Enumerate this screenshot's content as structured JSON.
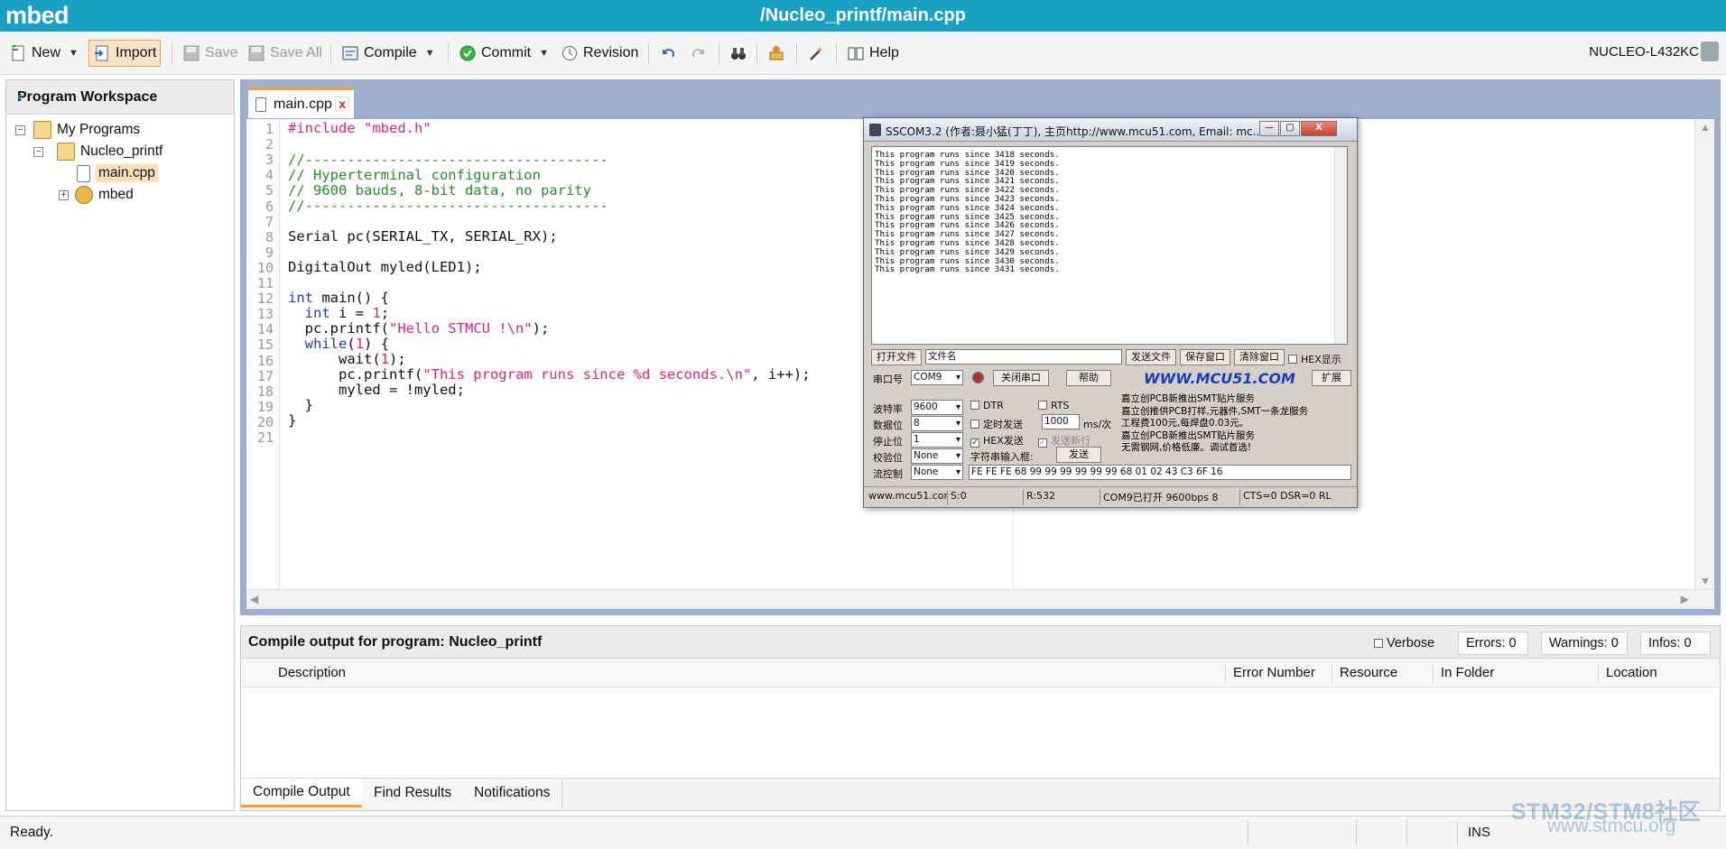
{
  "app": {
    "brand": "mbed",
    "path": "/Nucleo_printf/main.cpp"
  },
  "toolbar": {
    "new": "New",
    "import": "Import",
    "save": "Save",
    "save_all": "Save All",
    "compile": "Compile",
    "commit": "Commit",
    "revision": "Revision",
    "help": "Help",
    "board": "NUCLEO-L432KC"
  },
  "workspace": {
    "title": "Program Workspace",
    "root": "My Programs",
    "program": "Nucleo_printf",
    "file": "main.cpp",
    "lib": "mbed"
  },
  "editor": {
    "tab": "main.cpp",
    "tab_close": "x",
    "line_numbers": [
      "1",
      "2",
      "3",
      "4",
      "5",
      "6",
      "7",
      "8",
      "9",
      "10",
      "11",
      "12",
      "13",
      "14",
      "15",
      "16",
      "17",
      "18",
      "19",
      "20",
      "21"
    ]
  },
  "code": {
    "l1": "#include \"mbed.h\"",
    "l3": "//------------------------------------",
    "l4": "// Hyperterminal configuration",
    "l5": "// 9600 bauds, 8-bit data, no parity",
    "l6": "//------------------------------------",
    "l8": "Serial pc(SERIAL_TX, SERIAL_RX);",
    "l10": "DigitalOut myled(LED1);",
    "l12a": "int",
    "l12b": " main() {",
    "l13a": "  ",
    "l13b": "int",
    "l13c": " i = ",
    "l13d": "1",
    "l13e": ";",
    "l14a": "  pc.printf(",
    "l14b": "\"Hello STMCU !\\n\"",
    "l14c": ");",
    "l15a": "  ",
    "l15b": "while",
    "l15c": "(",
    "l15d": "1",
    "l15e": ") {",
    "l16a": "      wait(",
    "l16b": "1",
    "l16c": ");",
    "l17a": "      pc.printf(",
    "l17b": "\"This program runs since %d seconds.\\n\"",
    "l17c": ", i++);",
    "l18": "      myled = !myled;",
    "l19": "  }",
    "l20": "}"
  },
  "output": {
    "title": "Compile output for program: Nucleo_printf",
    "verbose": "Verbose",
    "errors": "Errors: 0",
    "warnings": "Warnings: 0",
    "infos": "Infos: 0",
    "columns": [
      "Description",
      "Error Number",
      "Resource",
      "In Folder",
      "Location"
    ],
    "tabs": [
      "Compile Output",
      "Find Results",
      "Notifications"
    ]
  },
  "status": {
    "ready": "Ready.",
    "ins": "INS"
  },
  "watermark": {
    "line1": "STM32/STM8社区",
    "line2": "www.stmcu.org"
  },
  "sscom": {
    "title": "SSCOM3.2 (作者:聂小猛(丁丁), 主页http://www.mcu51.com,  Email: mc...",
    "received": [
      "This program runs since 3418 seconds.",
      "This program runs since 3419 seconds.",
      "This program runs since 3420 seconds.",
      "This program runs since 3421 seconds.",
      "This program runs since 3422 seconds.",
      "This program runs since 3423 seconds.",
      "This program runs since 3424 seconds.",
      "This program runs since 3425 seconds.",
      "This program runs since 3426 seconds.",
      "This program runs since 3427 seconds.",
      "This program runs since 3428 seconds.",
      "This program runs since 3429 seconds.",
      "This program runs since 3430 seconds.",
      "This program runs since 3431 seconds."
    ],
    "open_file": "打开文件",
    "file_name": "文件名",
    "send_file": "发送文件",
    "save_window": "保存窗口",
    "clear_window": "清除窗口",
    "hex_display": "HEX显示",
    "port_label": "串口号",
    "port": "COM9",
    "close_port": "关闭串口",
    "help": "帮助",
    "site": "WWW.MCU51.COM",
    "expand": "扩展",
    "baud_label": "波特率",
    "baud": "9600",
    "data_label": "数据位",
    "data": "8",
    "stop_label": "停止位",
    "stop": "1",
    "parity_label": "校验位",
    "parity": "None",
    "flow_label": "流控制",
    "flow": "None",
    "dtr": "DTR",
    "rts": "RTS",
    "timed_send": "定时发送",
    "interval": "1000",
    "interval_unit": "ms/次",
    "hex_send": "HEX发送",
    "send_newline": "发送新行",
    "input_label": "字符串输入框:",
    "send": "发送",
    "send_data": "FE FE FE 68 99 99 99 99 99 99 68 01 02 43 C3 6F 16",
    "ad1": "嘉立创PCB新推出SMT贴片服务",
    "ad2": "嘉立创推供PCB打样,元器件,SMT一条龙服务",
    "ad3": "工程费100元,每焊盘0.03元。",
    "ad4": "嘉立创PCB新推出SMT贴片服务",
    "ad5": "无需钢网,价格低廉。调试首选!",
    "st1": "www.mcu51.cor",
    "st2": "S:0",
    "st3": "R:532",
    "st4": "COM9已打开  9600bps  8",
    "st5": "CTS=0 DSR=0 RL"
  }
}
